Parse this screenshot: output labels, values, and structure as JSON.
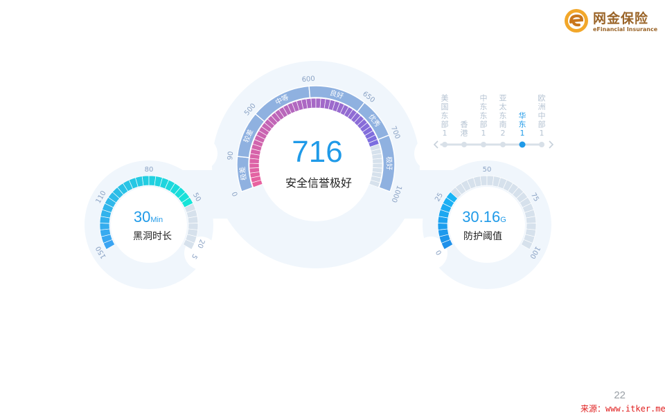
{
  "brand": {
    "title": "网金保险",
    "subtitle": "eFinancial Insurance"
  },
  "center_gauge": {
    "value": "716",
    "caption": "安全信誉极好",
    "tick_labels": [
      "0",
      "90",
      "500",
      "600",
      "650",
      "700",
      "1000"
    ],
    "band_labels": [
      "极差",
      "较差",
      "中等",
      "良好",
      "优秀",
      "极好"
    ],
    "fill_fraction": 0.825,
    "colors": {
      "band": "#8fb1e0",
      "fill_start": "#e8619f",
      "fill_end": "#7b6ee0",
      "empty": "#d6e1ec"
    }
  },
  "left_gauge": {
    "value": "30",
    "unit": "Min",
    "caption": "黑洞时长",
    "tick_labels": [
      "150",
      "110",
      "80",
      "50",
      "20",
      "5"
    ],
    "fill_fraction": 0.78,
    "colors": {
      "fill_start": "#3aa4f2",
      "fill_end": "#16e4d8",
      "empty": "#d6e1ec"
    }
  },
  "right_gauge": {
    "value": "30.16",
    "unit": "G",
    "caption": "防护阈值",
    "tick_labels": [
      "0",
      "25",
      "50",
      "75",
      "100"
    ],
    "fill_fraction": 0.3,
    "colors": {
      "fill_start": "#1e90ea",
      "fill_end": "#19b4f5",
      "empty": "#d6e1ec"
    }
  },
  "region_slider": {
    "items": [
      {
        "label": "美国东部",
        "count": "1"
      },
      {
        "label": "香港",
        "count": ""
      },
      {
        "label": "中东东部",
        "count": "1"
      },
      {
        "label": "亚太东南",
        "count": "2"
      },
      {
        "label": "华东",
        "count": "1"
      },
      {
        "label": "欧洲中部",
        "count": "1"
      }
    ],
    "selected_index": 4,
    "prev_icon": "chevron-left-icon",
    "next_icon": "chevron-right-icon"
  },
  "footer": {
    "page_number": "22",
    "source_text": "来源：www.itker.me"
  },
  "colors": {
    "halo": "#f0f6fc",
    "ring_bg": "#ffffff",
    "accent_text": "#1f9ae8",
    "body_text": "#222222"
  }
}
